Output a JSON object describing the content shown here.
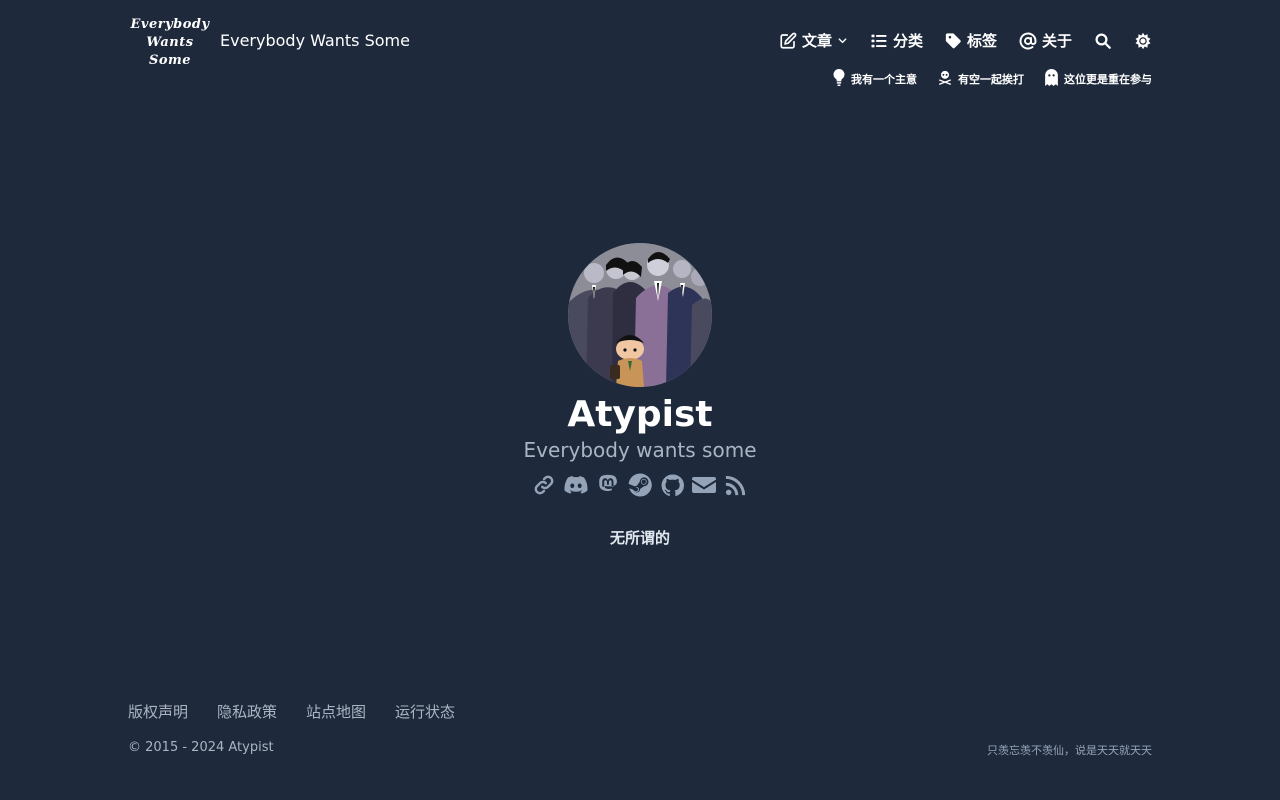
{
  "header": {
    "logo_lines": [
      "Everybody",
      "Wants",
      "Some"
    ],
    "site_title": "Everybody Wants Some",
    "nav": [
      {
        "label": "文章",
        "icon": "edit-icon",
        "dropdown": true
      },
      {
        "label": "分类",
        "icon": "list-icon"
      },
      {
        "label": "标签",
        "icon": "tag-icon"
      },
      {
        "label": "关于",
        "icon": "at-icon"
      }
    ],
    "sub_nav": [
      {
        "label": "我有一个主意",
        "icon": "lightbulb-icon"
      },
      {
        "label": "有空一起挨打",
        "icon": "skull-crossbones-icon"
      },
      {
        "label": "这位更是重在参与",
        "icon": "ghost-icon"
      }
    ]
  },
  "profile": {
    "name": "Atypist",
    "subtitle": "Everybody wants some",
    "social_icons": [
      "link-icon",
      "discord-icon",
      "mastodon-icon",
      "steam-icon",
      "github-icon",
      "email-icon",
      "rss-icon"
    ],
    "motto": "无所谓的"
  },
  "footer": {
    "links": [
      "版权声明",
      "隐私政策",
      "站点地图",
      "运行状态"
    ],
    "copyright": "© 2015 - 2024 Atypist",
    "note": "只羡忘羡不羡仙，说是天天就天天"
  },
  "colors": {
    "background": "#1e293b",
    "text": "#ffffff",
    "muted": "#aab4c3",
    "icon": "#94a3b8"
  }
}
